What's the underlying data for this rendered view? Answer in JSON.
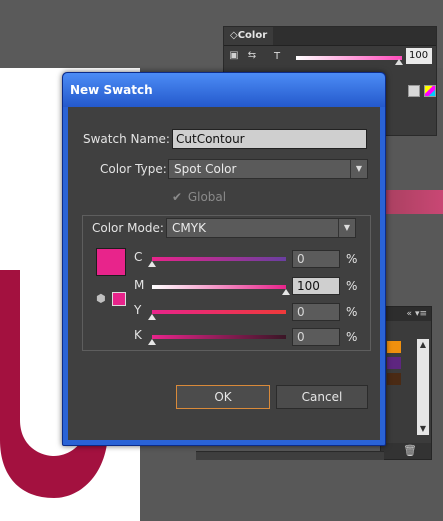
{
  "color_panel": {
    "tab_label": "Color",
    "channel_label": "T",
    "value": "100"
  },
  "dialog": {
    "title": "New Swatch",
    "swatch_name_label": "Swatch Name:",
    "swatch_name_value": "CutContour",
    "color_type_label": "Color Type:",
    "color_type_value": "Spot Color",
    "global_label": "Global",
    "global_checked": true,
    "color_mode_label": "Color Mode:",
    "color_mode_value": "CMYK",
    "swatch_color": "#e8248b",
    "channels": [
      {
        "label": "C",
        "value": "0",
        "unit": "%"
      },
      {
        "label": "M",
        "value": "100",
        "unit": "%"
      },
      {
        "label": "Y",
        "value": "0",
        "unit": "%"
      },
      {
        "label": "K",
        "value": "0",
        "unit": "%"
      }
    ],
    "ok_label": "OK",
    "cancel_label": "Cancel"
  },
  "icons": {
    "color_panel_collapse": "double-chevron-icon",
    "fill_stroke": "fill-stroke-icon",
    "swap": "swap-arrows-icon",
    "spot_color": "spot-color-icon",
    "trash": "trash-icon"
  }
}
